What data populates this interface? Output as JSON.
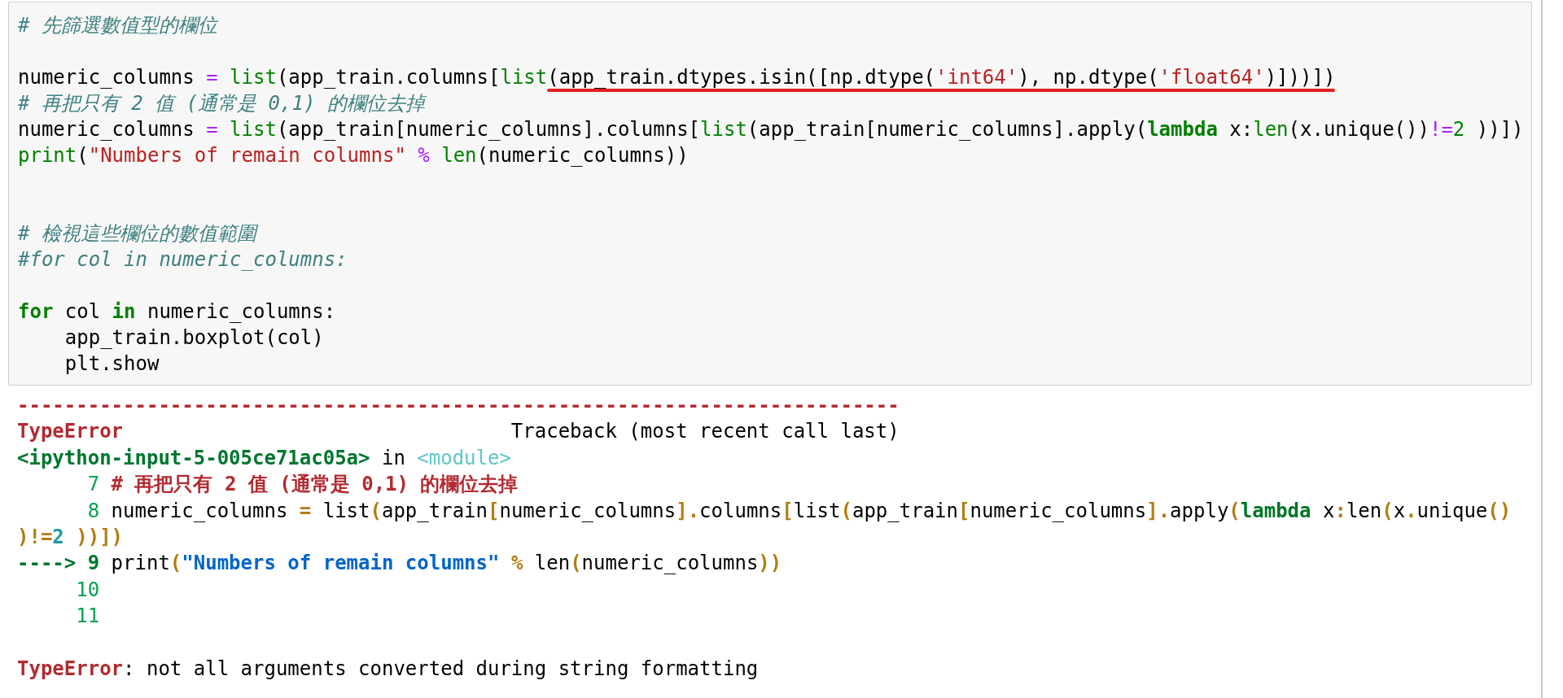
{
  "code_cell": {
    "lines": [
      {
        "kind": "code",
        "tokens": [
          {
            "text": "# 先篩選數值型的欄位",
            "kind": "comment"
          }
        ]
      },
      {
        "kind": "blank"
      },
      {
        "kind": "code",
        "tokens": [
          {
            "text": "numeric_columns ",
            "kind": "plain"
          },
          {
            "text": "= ",
            "kind": "operator"
          },
          {
            "text": "list",
            "kind": "builtin"
          },
          {
            "text": "(app_train.columns[",
            "kind": "plain"
          },
          {
            "text": "list",
            "kind": "builtin"
          },
          {
            "text": "(app_train.dtypes.isin([np.dtype(",
            "kind": "plain",
            "underlined": true
          },
          {
            "text": "'int64'",
            "kind": "string",
            "underlined": true
          },
          {
            "text": "), np.dtype(",
            "kind": "plain",
            "underlined": true
          },
          {
            "text": "'float64'",
            "kind": "string",
            "underlined": true
          },
          {
            "text": ")]))])",
            "kind": "plain",
            "underlined": true
          }
        ]
      },
      {
        "kind": "code",
        "tokens": [
          {
            "text": "# 再把只有 2 值 (通常是 0,1) 的欄位去掉",
            "kind": "comment"
          }
        ]
      },
      {
        "kind": "code",
        "tokens": [
          {
            "text": "numeric_columns ",
            "kind": "plain"
          },
          {
            "text": "= ",
            "kind": "operator"
          },
          {
            "text": "list",
            "kind": "builtin"
          },
          {
            "text": "(app_train[numeric_columns].columns[",
            "kind": "plain"
          },
          {
            "text": "list",
            "kind": "builtin"
          },
          {
            "text": "(app_train[numeric_columns].apply(",
            "kind": "plain"
          },
          {
            "text": "lambda",
            "kind": "keyword"
          },
          {
            "text": " x:",
            "kind": "plain"
          },
          {
            "text": "len",
            "kind": "builtin"
          },
          {
            "text": "(x.unique())",
            "kind": "plain"
          },
          {
            "text": "!=",
            "kind": "operator"
          },
          {
            "text": "2",
            "kind": "number"
          },
          {
            "text": " ))])",
            "kind": "plain"
          }
        ]
      },
      {
        "kind": "code",
        "tokens": [
          {
            "text": "print",
            "kind": "builtin"
          },
          {
            "text": "(",
            "kind": "plain"
          },
          {
            "text": "\"Numbers of remain columns\"",
            "kind": "string"
          },
          {
            "text": " % ",
            "kind": "operator"
          },
          {
            "text": "len",
            "kind": "builtin"
          },
          {
            "text": "(numeric_columns))",
            "kind": "plain"
          }
        ]
      },
      {
        "kind": "blank"
      },
      {
        "kind": "blank"
      },
      {
        "kind": "code",
        "tokens": [
          {
            "text": "# 檢視這些欄位的數值範圍",
            "kind": "comment"
          }
        ]
      },
      {
        "kind": "code",
        "tokens": [
          {
            "text": "#for col in numeric_columns:",
            "kind": "comment"
          }
        ]
      },
      {
        "kind": "blank"
      },
      {
        "kind": "code",
        "tokens": [
          {
            "text": "for",
            "kind": "keyword"
          },
          {
            "text": " col ",
            "kind": "plain"
          },
          {
            "text": "in",
            "kind": "keyword"
          },
          {
            "text": " numeric_columns:",
            "kind": "plain"
          }
        ]
      },
      {
        "kind": "code",
        "tokens": [
          {
            "text": "    app_train.boxplot(col)",
            "kind": "plain"
          }
        ]
      },
      {
        "kind": "code",
        "tokens": [
          {
            "text": "    plt.show",
            "kind": "plain"
          }
        ]
      }
    ]
  },
  "output": {
    "lines": [
      {
        "kind": "code",
        "tokens": [
          {
            "text": "---------------------------------------------------------------------------",
            "kind": "error"
          }
        ]
      },
      {
        "kind": "code",
        "tokens": [
          {
            "text": "TypeError",
            "kind": "error"
          },
          {
            "text": "                                 Traceback (most recent call last)",
            "kind": "plain"
          }
        ]
      },
      {
        "kind": "code",
        "tokens": [
          {
            "text": "<ipython-input-5-005ce71ac05a>",
            "kind": "file"
          },
          {
            "text": " in ",
            "kind": "plain"
          },
          {
            "text": "<module>",
            "kind": "module"
          }
        ]
      },
      {
        "kind": "code",
        "tokens": [
          {
            "text": "      7 ",
            "kind": "lineno"
          },
          {
            "text": "# 再把只有 2 值 (通常是 0,1) 的欄位去掉",
            "kind": "error"
          }
        ]
      },
      {
        "kind": "code",
        "tokens": [
          {
            "text": "      8 ",
            "kind": "lineno"
          },
          {
            "text": "numeric_columns ",
            "kind": "plain"
          },
          {
            "text": "=",
            "kind": "punct"
          },
          {
            "text": " list",
            "kind": "plain"
          },
          {
            "text": "(",
            "kind": "punct"
          },
          {
            "text": "app_train",
            "kind": "plain"
          },
          {
            "text": "[",
            "kind": "punct"
          },
          {
            "text": "numeric_columns",
            "kind": "plain"
          },
          {
            "text": "].",
            "kind": "punct"
          },
          {
            "text": "columns",
            "kind": "plain"
          },
          {
            "text": "[",
            "kind": "punct"
          },
          {
            "text": "list",
            "kind": "plain"
          },
          {
            "text": "(",
            "kind": "punct"
          },
          {
            "text": "app_train",
            "kind": "plain"
          },
          {
            "text": "[",
            "kind": "punct"
          },
          {
            "text": "numeric_columns",
            "kind": "plain"
          },
          {
            "text": "].",
            "kind": "punct"
          },
          {
            "text": "apply",
            "kind": "plain"
          },
          {
            "text": "(",
            "kind": "punct"
          },
          {
            "text": "lambda",
            "kind": "keyword"
          },
          {
            "text": " x",
            "kind": "plain"
          },
          {
            "text": ":",
            "kind": "punct"
          },
          {
            "text": "len",
            "kind": "plain"
          },
          {
            "text": "(",
            "kind": "punct"
          },
          {
            "text": "x",
            "kind": "plain"
          },
          {
            "text": ".",
            "kind": "punct"
          },
          {
            "text": "unique",
            "kind": "plain"
          },
          {
            "text": "()",
            "kind": "punct"
          }
        ]
      },
      {
        "kind": "code",
        "tokens": [
          {
            "text": ")!=",
            "kind": "punct"
          },
          {
            "text": "2 ",
            "kind": "number"
          },
          {
            "text": "))])",
            "kind": "punct"
          }
        ]
      },
      {
        "kind": "code",
        "tokens": [
          {
            "text": "----> 9 ",
            "kind": "arrow"
          },
          {
            "text": "print",
            "kind": "plain"
          },
          {
            "text": "(",
            "kind": "punct"
          },
          {
            "text": "\"Numbers of remain columns\"",
            "kind": "string"
          },
          {
            "text": " %",
            "kind": "punct"
          },
          {
            "text": " len",
            "kind": "plain"
          },
          {
            "text": "(",
            "kind": "punct"
          },
          {
            "text": "numeric_columns",
            "kind": "plain"
          },
          {
            "text": "))",
            "kind": "punct"
          }
        ]
      },
      {
        "kind": "code",
        "tokens": [
          {
            "text": "     10",
            "kind": "lineno"
          }
        ]
      },
      {
        "kind": "code",
        "tokens": [
          {
            "text": "     11",
            "kind": "lineno"
          }
        ]
      },
      {
        "kind": "blank"
      },
      {
        "kind": "code",
        "tokens": [
          {
            "text": "TypeError",
            "kind": "error"
          },
          {
            "text": ": not all arguments converted during string formatting",
            "kind": "plain"
          }
        ]
      }
    ]
  }
}
